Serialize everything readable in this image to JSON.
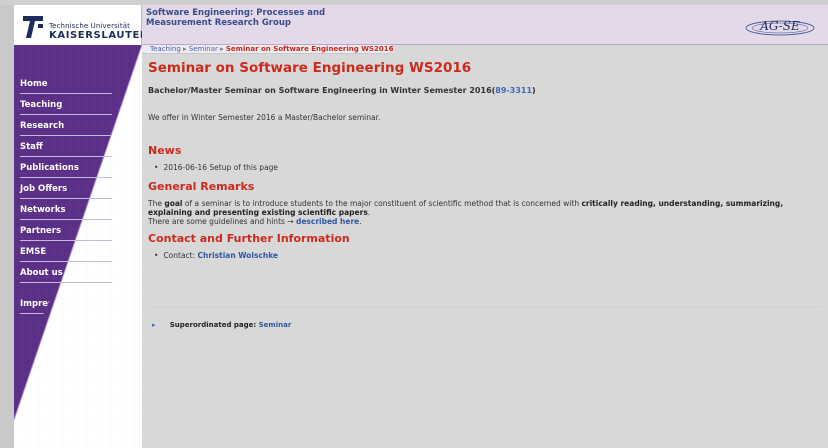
{
  "logo": {
    "line1": "Technische Universität",
    "line2": "KAISERSLAUTERN"
  },
  "header": {
    "title_line1": "Software Engineering: Processes and",
    "title_line2": "Measurement Research Group",
    "agse_label": "AG-SE"
  },
  "breadcrumb": {
    "items": [
      "Teaching",
      "Seminar"
    ],
    "current": "Seminar on Software Engineering WS2016"
  },
  "nav": {
    "items": [
      {
        "label": "Home"
      },
      {
        "label": "Teaching"
      },
      {
        "label": "Research"
      },
      {
        "label": "Staff"
      },
      {
        "label": "Publications"
      },
      {
        "label": "Job Offers"
      },
      {
        "label": "Networks"
      },
      {
        "label": "Partners"
      },
      {
        "label": "EMSE"
      },
      {
        "label": "About us"
      },
      {
        "label": "Impressum"
      }
    ]
  },
  "main": {
    "title": "Seminar on Software Engineering WS2016",
    "subtitle_prefix": "Bachelor/Master Seminar on Software Engineering in Winter Semester 2016(",
    "subtitle_link": "89-3311",
    "subtitle_suffix": ")",
    "intro": "We offer in Winter Semester 2016 a Master/Bachelor seminar.",
    "news_heading": "News",
    "news_items": [
      "2016-06-16 Setup of this page"
    ],
    "general_heading": "General Remarks",
    "general_p1_a": "The ",
    "general_p1_goal": "goal",
    "general_p1_b": " of a seminar is to introduce students to the major constituent of scientific method that is concerned with ",
    "general_p1_bold": "critically reading, understanding, summarizing, explaining and presenting existing scientific papers",
    "general_p1_end": ".",
    "general_p2_a": "There are some guidelines and hints → ",
    "general_p2_link": "described here",
    "general_p2_end": ".",
    "contact_heading": "Contact and Further Information",
    "contact_label": "Contact: ",
    "contact_name": "Christian Wolschke"
  },
  "footer": {
    "super_label": "Superordinated page: ",
    "super_link": "Seminar"
  },
  "colors": {
    "heading_red": "#cc2a1c",
    "link_blue": "#2d57a3",
    "sidebar_purple": "#5a2f86",
    "header_lilac": "#e3d9ea"
  }
}
